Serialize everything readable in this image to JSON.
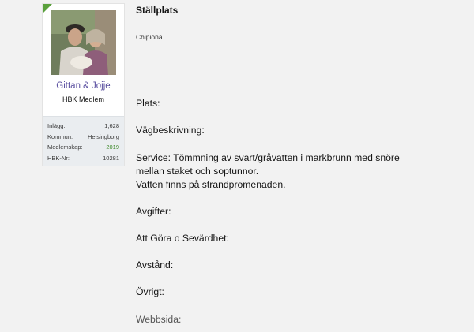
{
  "user": {
    "name": "Gittan & Jojje",
    "title": "HBK Medlem",
    "stats": [
      {
        "label": "Inlägg:",
        "value": "1,628"
      },
      {
        "label": "Kommun:",
        "value": "Helsingborg"
      },
      {
        "label": "Medlemskap:",
        "value": "2019"
      },
      {
        "label": "HBK-Nr:",
        "value": "10281"
      }
    ]
  },
  "post": {
    "title": "Ställplats",
    "subtitle": "Chipiona",
    "plats": "Plats:",
    "vagbeskrivning": "Vägbeskrivning:",
    "service_line1": "Service: Tömmning av svart/gråvatten i markbrunn med snöre",
    "service_line2": "mellan staket och soptunnor.",
    "service_line3": "Vatten finns på strandpromenaden.",
    "avgifter": "Avgifter:",
    "att_gora": "Att Göra o Sevärdhet:",
    "avstand": "Avstånd:",
    "ovrigt": "Övrigt:",
    "webbsida": "Webbsida:"
  },
  "colors": {
    "online": "#5aa03c",
    "username": "#5a4fa0",
    "membership_year": "#3d8a2a"
  }
}
